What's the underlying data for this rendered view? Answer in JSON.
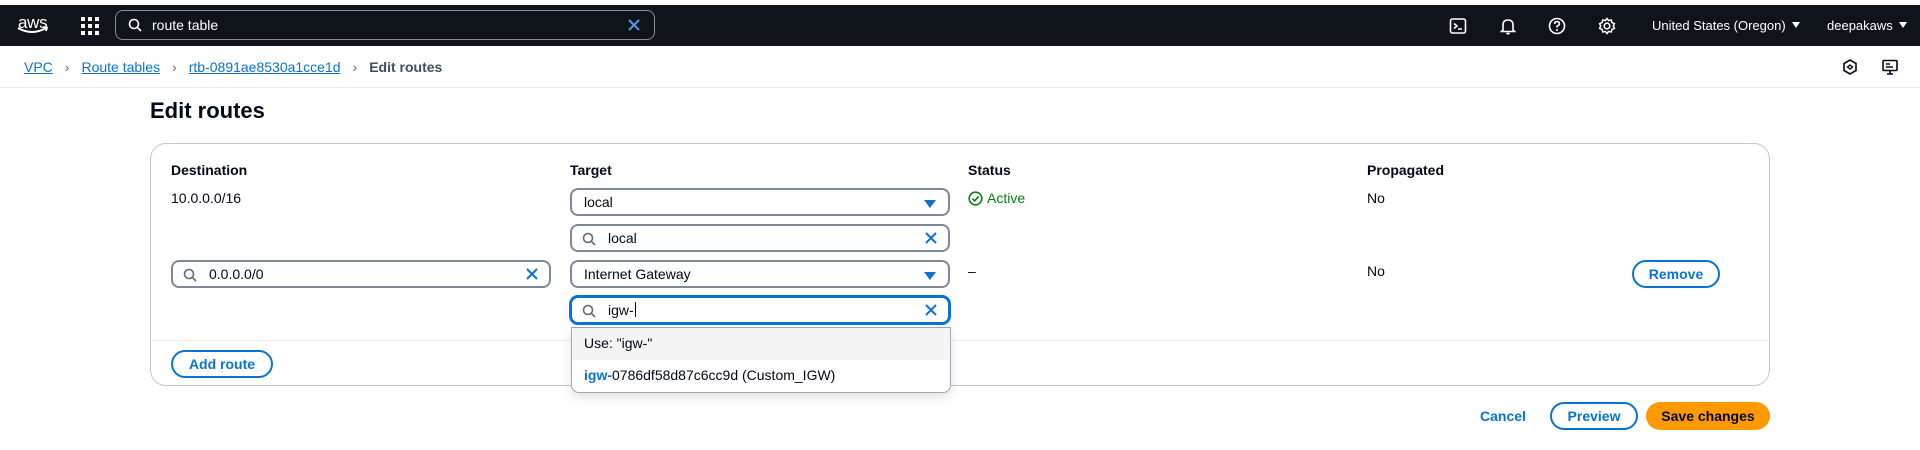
{
  "topnav": {
    "logo_text": "aws",
    "search_value": "route table",
    "region": "United States (Oregon)",
    "user": "deepakaws",
    "icons": [
      "cloudshell-icon",
      "notifications-icon",
      "help-icon",
      "settings-icon"
    ]
  },
  "breadcrumb": {
    "items": [
      "VPC",
      "Route tables",
      "rtb-0891ae8530a1cce1d"
    ],
    "current": "Edit routes"
  },
  "page": {
    "title": "Edit routes"
  },
  "table": {
    "headers": [
      "Destination",
      "Target",
      "Status",
      "Propagated"
    ],
    "rows": [
      {
        "destination": "10.0.0.0/16",
        "target": "local",
        "target_filter": "local",
        "status": "Active",
        "propagated": "No"
      },
      {
        "destination": "0.0.0.0/0",
        "target": "Internet Gateway",
        "target_filter": "igw-",
        "status": "–",
        "propagated": "No",
        "remove_label": "Remove"
      }
    ],
    "add_route_label": "Add route"
  },
  "dropdown": {
    "use_option": "Use: \"igw-\"",
    "option_highlight": "igw-",
    "option_rest": "0786df58d87c6cc9d (Custom_IGW)"
  },
  "footer": {
    "cancel_label": "Cancel",
    "preview_label": "Preview",
    "save_label": "Save changes"
  },
  "colors": {
    "nav_bg": "#0f141a",
    "link": "#0972d3",
    "success": "#037f0c",
    "primary_button": "#ff9900"
  }
}
